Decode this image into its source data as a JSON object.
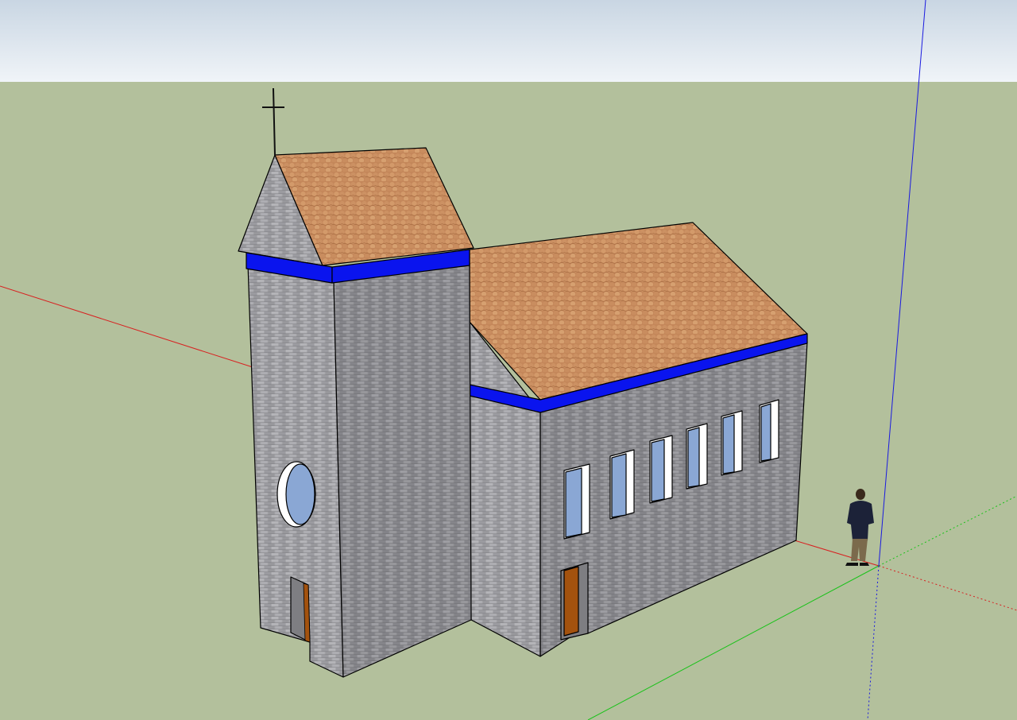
{
  "viewport": {
    "colors": {
      "sky_top": "#c9d6e3",
      "sky_bottom": "#f0f4f8",
      "ground": "#b3c09c",
      "axis_red": "#d82020",
      "axis_green": "#19c219",
      "axis_blue": "#1a1ae0",
      "wall_light": "#a4a4a8",
      "wall_dark": "#8e8e92",
      "roof": "#c8895a",
      "trim_band": "#0a14ee",
      "window_glass": "#8aa7d4",
      "door": "#a3520e",
      "outline": "#000000"
    },
    "model": {
      "name": "church",
      "tower_windows": [
        "round-window"
      ],
      "nave_windows": [
        "nave-window-1",
        "nave-window-2",
        "nave-window-3",
        "nave-window-4",
        "nave-window-5",
        "nave-window-6"
      ],
      "doors": [
        "tower-door",
        "nave-door"
      ],
      "icons": [
        "cross-icon",
        "scale-figure-icon"
      ]
    }
  }
}
